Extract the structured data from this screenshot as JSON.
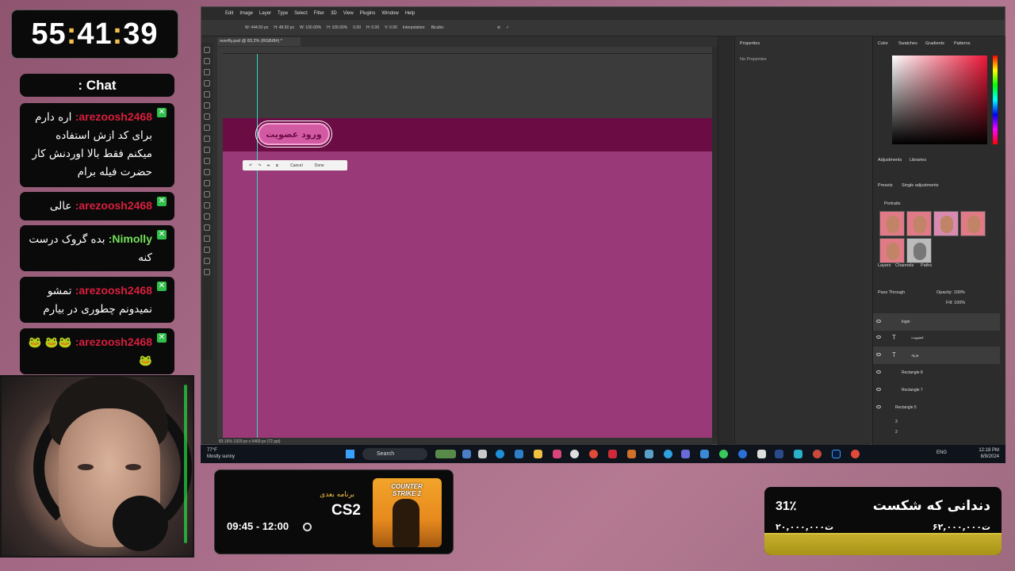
{
  "timer": {
    "hh": "55",
    "mm": "41",
    "ss": "39",
    "sep": ":"
  },
  "chat": {
    "title": ": Chat",
    "messages": [
      {
        "user": "arezoosh2468:",
        "text": "اره دارم برای کد ازش استفاده میکنم فقط بالا اوردنش کار حضرت فیله برام",
        "color": "red"
      },
      {
        "user": "arezoosh2468:",
        "text": "عالی",
        "color": "red"
      },
      {
        "user": "Nimolly:",
        "text": "بده گروک درست کنه",
        "color": "green"
      },
      {
        "user": "arezoosh2468:",
        "text": "تمشو نمیدونم چطوری در بیارم",
        "color": "red"
      },
      {
        "user": "arezoosh2468:",
        "text": "🐸🐸 🐸🐸",
        "color": "red"
      }
    ],
    "badge": "✕"
  },
  "photoshop": {
    "menu": [
      "Edit",
      "Image",
      "Layer",
      "Type",
      "Select",
      "Filter",
      "3D",
      "View",
      "Plugins",
      "Window",
      "Help"
    ],
    "options": [
      "W: 444.50 px",
      "H: 48.50 px",
      "W: 100.00%",
      "H: 100.00%",
      "0.00",
      "H: 0.00",
      "V: 0.00",
      "Interpolation:",
      "Bicubic"
    ],
    "tab": "overfly.psd @ 83.2% (RGB/8#) *",
    "canvas_button": "ورود عضویت",
    "transform": {
      "cancel": "Cancel",
      "done": "Done"
    },
    "status": "83.16%    1920 px x 9469 px (72 ppi)",
    "properties": {
      "title": "Properties",
      "empty": "No Properties"
    },
    "color_tabs": [
      "Color",
      "Swatches",
      "Gradients",
      "Patterns"
    ],
    "adjust_tabs": [
      "Adjustments",
      "Libraries"
    ],
    "presets": [
      "Presets",
      "Single adjustments"
    ],
    "portraits": "Portraits",
    "layers_tabs": [
      "Layers",
      "Channels",
      "Paths"
    ],
    "blend": "Pass Through",
    "opacity": "Opacity: 100%",
    "fill": "Fill: 100%",
    "layers": [
      {
        "name": "login",
        "kind": "folder"
      },
      {
        "name": "عضویت",
        "kind": "text"
      },
      {
        "name": "ورود",
        "kind": "text"
      },
      {
        "name": "Rectangle 8",
        "kind": "shape"
      },
      {
        "name": "Rectangle 7",
        "kind": "shape"
      },
      {
        "name": "Rectangle 5",
        "kind": "shape"
      },
      {
        "name": "3",
        "kind": "folder"
      },
      {
        "name": "2",
        "kind": "folder"
      }
    ]
  },
  "taskbar": {
    "weather_temp": "77°F",
    "weather_desc": "Mostly sunny",
    "search": "Search",
    "lang": "ENG",
    "time": "12:18 PM",
    "date": "8/9/2024"
  },
  "next": {
    "label": "برنامه بعدی",
    "game": "CS2",
    "time": "09:45 - 12:00",
    "cover_title": "COUNTER STRIKE 2"
  },
  "goal": {
    "title": "دندانی که شکست",
    "percent": "31٪",
    "progress": 0.31,
    "current": "۲۰,۰۰۰,۰۰۰ت",
    "target": "۶۲,۰۰۰,۰۰۰ت"
  }
}
